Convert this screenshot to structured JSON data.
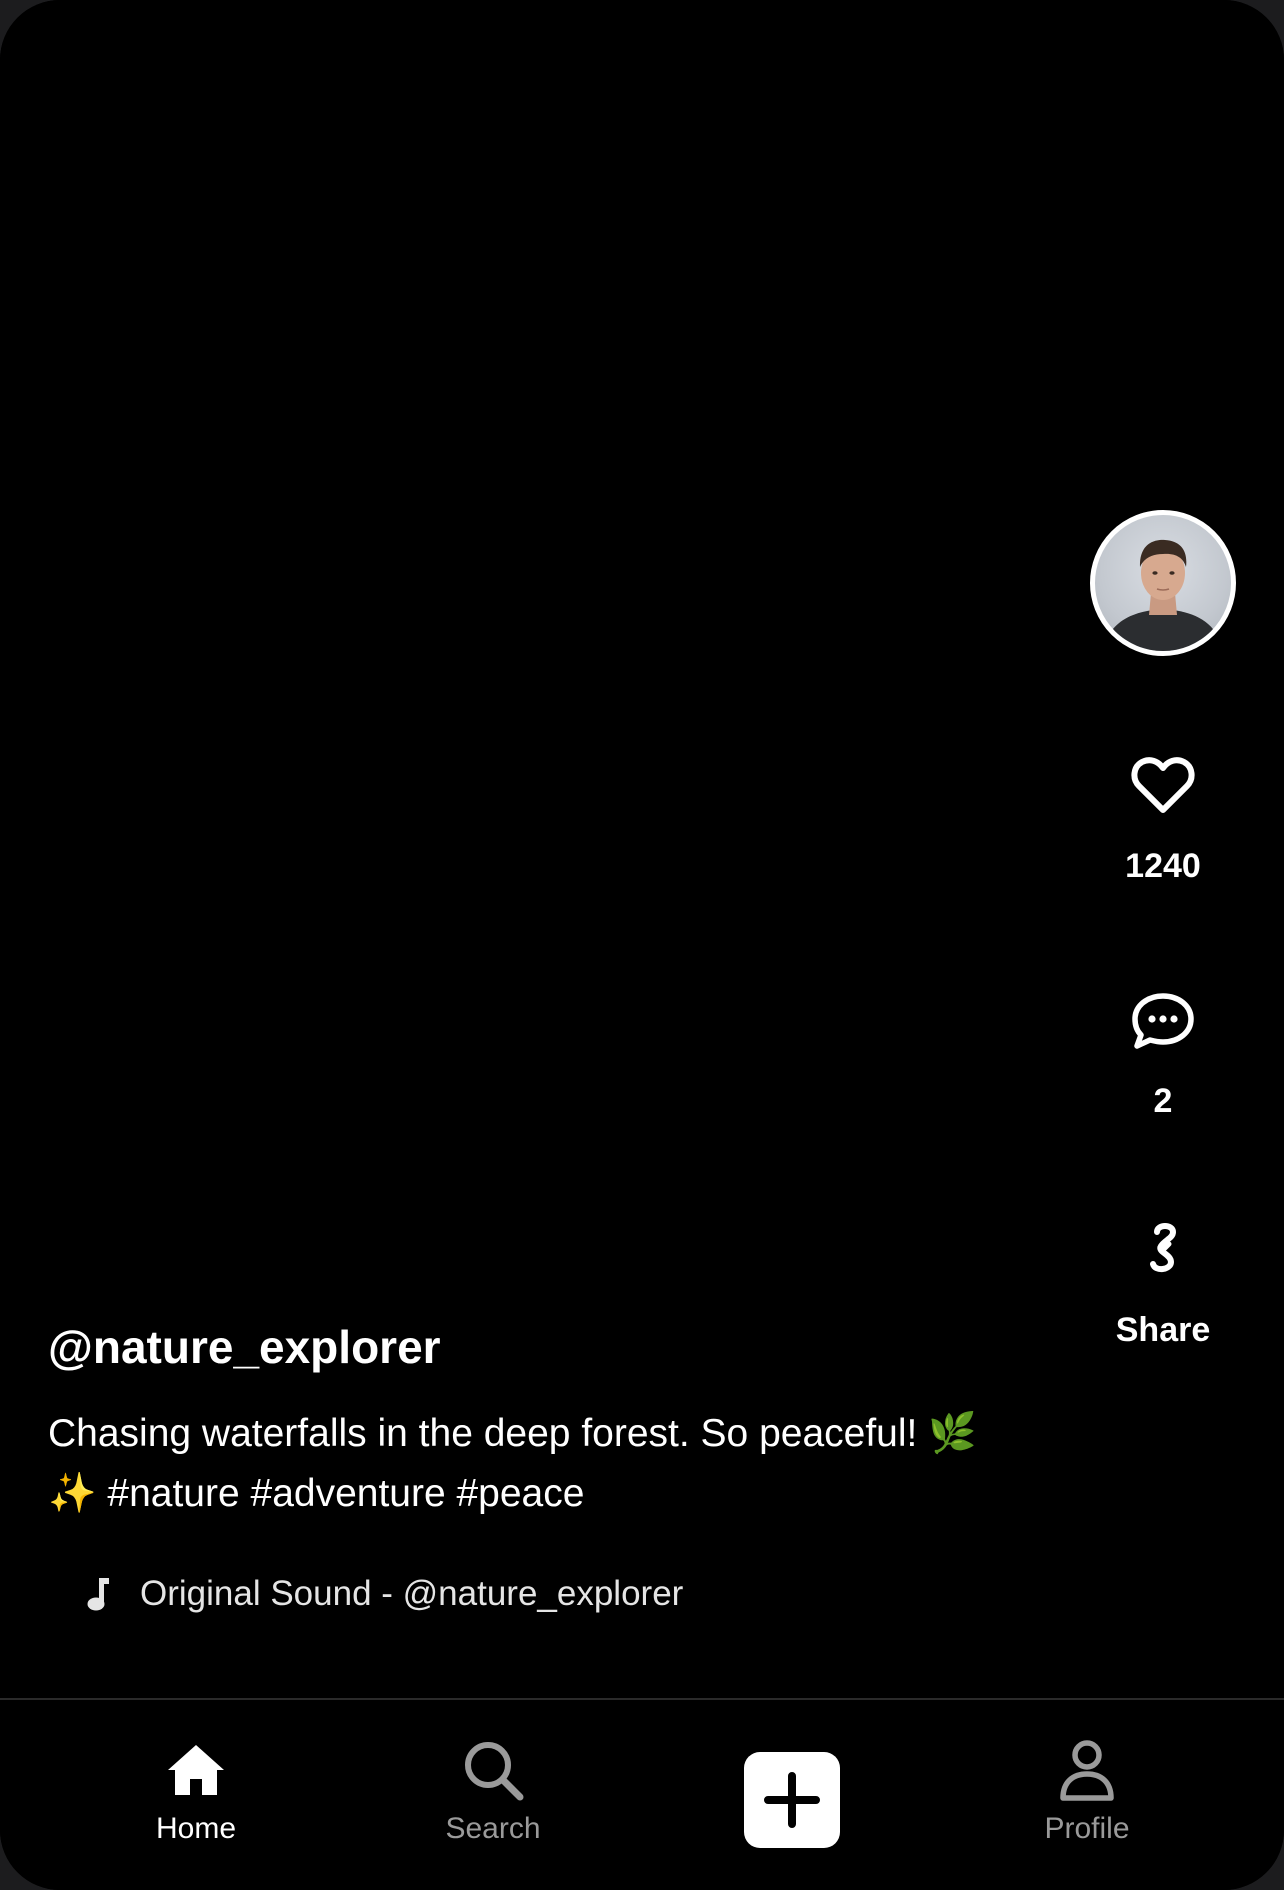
{
  "post": {
    "username": "@nature_explorer",
    "description": "Chasing waterfalls in the deep forest. So peaceful! 🌿✨ #nature #adventure #peace",
    "sound": "Original Sound - @nature_explorer"
  },
  "actions": {
    "likes": "1240",
    "comments": "2",
    "share_label": "Share"
  },
  "nav": {
    "home": "Home",
    "search": "Search",
    "profile": "Profile"
  },
  "icons": {
    "avatar": "avatar",
    "like": "heart-icon",
    "comment": "comment-icon",
    "share": "share-link-icon",
    "music": "music-note-icon",
    "home": "home-icon",
    "search": "search-icon",
    "create": "plus-icon",
    "profile": "user-icon"
  },
  "colors": {
    "background": "#000000",
    "text": "#ffffff",
    "inactive_nav": "#9a9a9a"
  }
}
